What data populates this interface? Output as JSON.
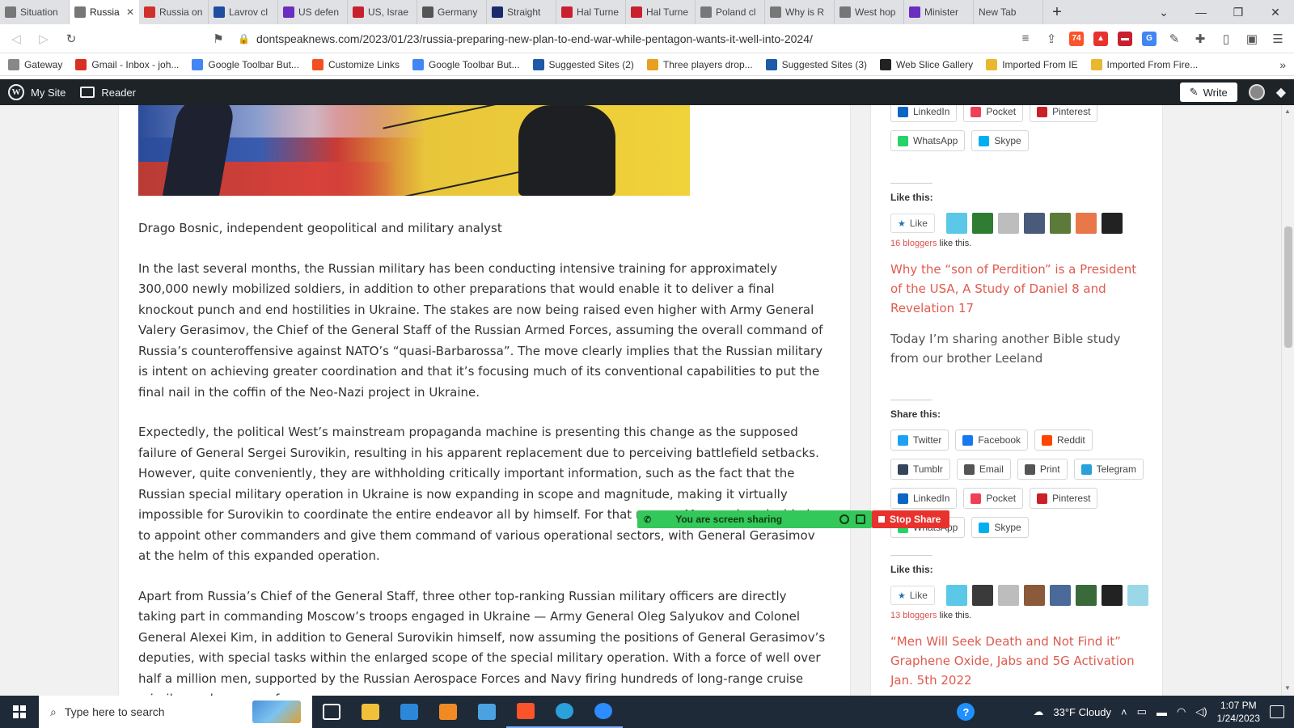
{
  "browser": {
    "tabs": [
      {
        "title": "Situation",
        "icon": "page-icon",
        "color": "#777777"
      },
      {
        "title": "Russia",
        "icon": "page-icon",
        "color": "#777777",
        "active": true
      },
      {
        "title": "Russia on",
        "icon": "flag-icon",
        "color": "#d0312d"
      },
      {
        "title": "Lavrov cl",
        "icon": "m-icon",
        "color": "#1f4e9e"
      },
      {
        "title": "US defen",
        "icon": "y-icon",
        "color": "#6a2ec0"
      },
      {
        "title": "US, Israe",
        "icon": "p-icon",
        "color": "#c8202f"
      },
      {
        "title": "Germany",
        "icon": "news-icon",
        "color": "#555555"
      },
      {
        "title": "Straight",
        "icon": "shield-icon",
        "color": "#1a2a6c"
      },
      {
        "title": "Hal Turne",
        "icon": "hal-icon",
        "color": "#c8202f"
      },
      {
        "title": "Hal Turne",
        "icon": "hal-icon",
        "color": "#c8202f"
      },
      {
        "title": "Poland cl",
        "icon": "page-icon",
        "color": "#777777"
      },
      {
        "title": "Why is R",
        "icon": "page-icon",
        "color": "#777777"
      },
      {
        "title": "West hop",
        "icon": "page-icon",
        "color": "#777777"
      },
      {
        "title": "Minister",
        "icon": "y-icon",
        "color": "#6a2ec0"
      },
      {
        "title": "New Tab",
        "icon": "",
        "color": "#dfe1e5"
      }
    ],
    "tab_close": "✕",
    "new_tab": "+",
    "url": "dontspeaknews.com/2023/01/23/russia-preparing-new-plan-to-end-war-while-pentagon-wants-it-well-into-2024/",
    "brave_badge": "74",
    "bookmarks": [
      {
        "label": "Gateway",
        "icon": "page-icon",
        "color": "#888888"
      },
      {
        "label": "Gmail - Inbox - joh...",
        "icon": "gmail-icon",
        "color": "#d93025"
      },
      {
        "label": "Google Toolbar But...",
        "icon": "google-icon",
        "color": "#4285f4"
      },
      {
        "label": "Customize Links",
        "icon": "windows-icon",
        "color": "#f25022"
      },
      {
        "label": "Google Toolbar But...",
        "icon": "google-icon",
        "color": "#4285f4"
      },
      {
        "label": "Suggested Sites (2)",
        "icon": "search-icon",
        "color": "#1e5aa8"
      },
      {
        "label": "Three players drop...",
        "icon": "yahoo-icon",
        "color": "#e8a020"
      },
      {
        "label": "Suggested Sites (3)",
        "icon": "search-icon",
        "color": "#1e5aa8"
      },
      {
        "label": "Web Slice Gallery",
        "icon": "y-icon",
        "color": "#222222"
      },
      {
        "label": "Imported From IE",
        "icon": "folder-icon",
        "color": "#e8b830"
      },
      {
        "label": "Imported From Fire...",
        "icon": "folder-icon",
        "color": "#e8b830"
      }
    ]
  },
  "wpbar": {
    "my_site": "My Site",
    "reader": "Reader",
    "write": "Write"
  },
  "article": {
    "byline": "Drago Bosnic, independent geopolitical and military analyst",
    "paragraphs": [
      "In the last several months, the Russian military has been conducting intensive training for approximately 300,000 newly mobilized soldiers, in addition to other preparations that would enable it to deliver a final knockout punch and end hostilities in Ukraine. The stakes are now being raised even higher with Army General Valery Gerasimov, the Chief of the General Staff of the Russian Armed Forces, assuming the overall command of Russia’s counteroffensive against NATO’s “quasi-Barbarossa”. The move clearly implies that the Russian military is intent on achieving greater coordination and that it’s focusing much of its conventional capabilities to put the final nail in the coffin of the Neo-Nazi project in Ukraine.",
      "Expectedly, the political West’s mainstream propaganda machine is presenting this change as the supposed failure of General Sergei Surovikin, resulting in his apparent replacement due to perceiving battlefield setbacks. However, quite conveniently, they are withholding critically important information, such as the fact that the Russian special military operation in Ukraine is now expanding in scope and magnitude, making it virtually impossible for Surovikin to coordinate the entire endeavor all by himself. For that reason, Moscow has decided to appoint other commanders and give them command of various operational sectors, with General Gerasimov at the helm of this expanded operation.",
      "Apart from Russia’s Chief of the General Staff, three other top-ranking Russian military officers are directly taking part in commanding Moscow’s troops engaged in Ukraine — Army General Oleg Salyukov and Colonel General Alexei Kim, in addition to General Surovikin himself, now assuming the positions of General Gerasimov’s deputies, with special tasks within the enlarged scope of the special military operation. With a force of well over half a million men, supported by the Russian Aerospace Forces and Navy firing hundreds of long-range cruise missiles and swarms of"
    ]
  },
  "sidebar": {
    "top_share_rows": [
      [
        {
          "label": "LinkedIn",
          "icon": "linkedin-icon",
          "color": "#0a66c2"
        },
        {
          "label": "Pocket",
          "icon": "pocket-icon",
          "color": "#ef4056"
        },
        {
          "label": "Pinterest",
          "icon": "pinterest-icon",
          "color": "#cb2027"
        }
      ],
      [
        {
          "label": "WhatsApp",
          "icon": "whatsapp-icon",
          "color": "#25d366"
        },
        {
          "label": "Skype",
          "icon": "skype-icon",
          "color": "#00aff0"
        }
      ]
    ],
    "like_heading": "Like this:",
    "like_label": "Like",
    "block1": {
      "avatars": [
        "#5bc8e8",
        "#2e7d32",
        "#bdbdbd",
        "#4a5a7a",
        "#5d7a3a",
        "#e8784a",
        "#222222"
      ],
      "bloggers_count": "16 bloggers",
      "bloggers_suffix": " like this.",
      "link": "Why the “son of Perdition” is a President of the USA, A Study of Daniel 8 and Revelation 17",
      "text": "Today I’m sharing another Bible study from our brother Leeland"
    },
    "share_heading": "Share this:",
    "share_rows": [
      [
        {
          "label": "Twitter",
          "icon": "twitter-icon",
          "color": "#1da1f2"
        },
        {
          "label": "Facebook",
          "icon": "facebook-icon",
          "color": "#1877f2"
        },
        {
          "label": "Reddit",
          "icon": "reddit-icon",
          "color": "#ff4500"
        }
      ],
      [
        {
          "label": "Tumblr",
          "icon": "tumblr-icon",
          "color": "#35465c"
        },
        {
          "label": "Email",
          "icon": "email-icon",
          "color": "#555555"
        },
        {
          "label": "Print",
          "icon": "print-icon",
          "color": "#555555"
        },
        {
          "label": "Telegram",
          "icon": "telegram-icon",
          "color": "#2aa1da"
        }
      ],
      [
        {
          "label": "LinkedIn",
          "icon": "linkedin-icon",
          "color": "#0a66c2"
        },
        {
          "label": "Pocket",
          "icon": "pocket-icon",
          "color": "#ef4056"
        },
        {
          "label": "Pinterest",
          "icon": "pinterest-icon",
          "color": "#cb2027"
        }
      ],
      [
        {
          "label": "WhatsApp",
          "icon": "whatsapp-icon",
          "color": "#25d366"
        },
        {
          "label": "Skype",
          "icon": "skype-icon",
          "color": "#00aff0"
        }
      ]
    ],
    "block2": {
      "avatars": [
        "#5bc8e8",
        "#3a3a3a",
        "#bdbdbd",
        "#8a5a3a",
        "#4a6a9a",
        "#3a6a3a",
        "#222222",
        "#9ad8e8"
      ],
      "bloggers_count": "13 bloggers",
      "bloggers_suffix": " like this.",
      "link": "“Men Will Seek Death and Not Find it” Graphene Oxide, Jabs and 5G Activation Jan. 5th 2022"
    }
  },
  "screen_share": {
    "message": "You are screen sharing",
    "stop_label": "Stop Share"
  },
  "taskbar": {
    "search_placeholder": "Type here to search",
    "apps": [
      {
        "name": "task-view",
        "color": "#ffffff"
      },
      {
        "name": "file-explorer",
        "color": "#f3c03a"
      },
      {
        "name": "store",
        "color": "#2b88d8"
      },
      {
        "name": "media",
        "color": "#f08a24"
      },
      {
        "name": "photos",
        "color": "#4aa3e0"
      },
      {
        "name": "brave",
        "color": "#fb542b"
      },
      {
        "name": "telegram",
        "color": "#2aa1da"
      },
      {
        "name": "zoom",
        "color": "#2d8cff"
      }
    ],
    "weather": "33°F  Cloudy",
    "time": "1:07 PM",
    "date": "1/24/2023"
  }
}
